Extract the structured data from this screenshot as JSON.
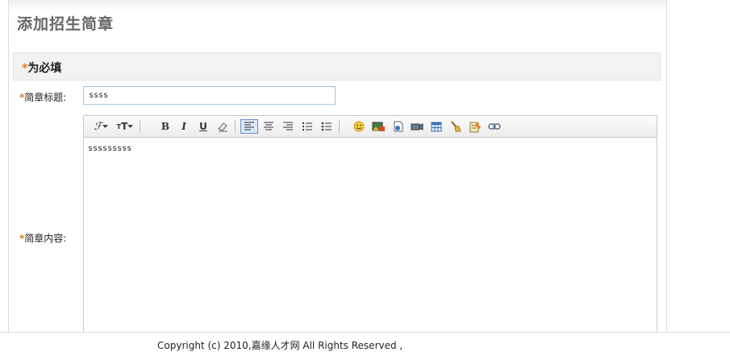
{
  "page": {
    "title": "添加招生简章"
  },
  "required_notice": {
    "star": "*",
    "text": "为必填"
  },
  "form": {
    "title_label": "简章标题:",
    "title_value": "ssss",
    "content_label": "简章内容:",
    "content_value": "sssssssss"
  },
  "toolbar": {
    "font_family": "ℱ",
    "font_size": "T",
    "font_size_small": "T",
    "bold": "B",
    "italic": "I",
    "underline": "U",
    "eraser": "⌫"
  },
  "footer": {
    "text": "Copyright (c) 2010,嘉缘人才网 All Rights Reserved ,"
  }
}
